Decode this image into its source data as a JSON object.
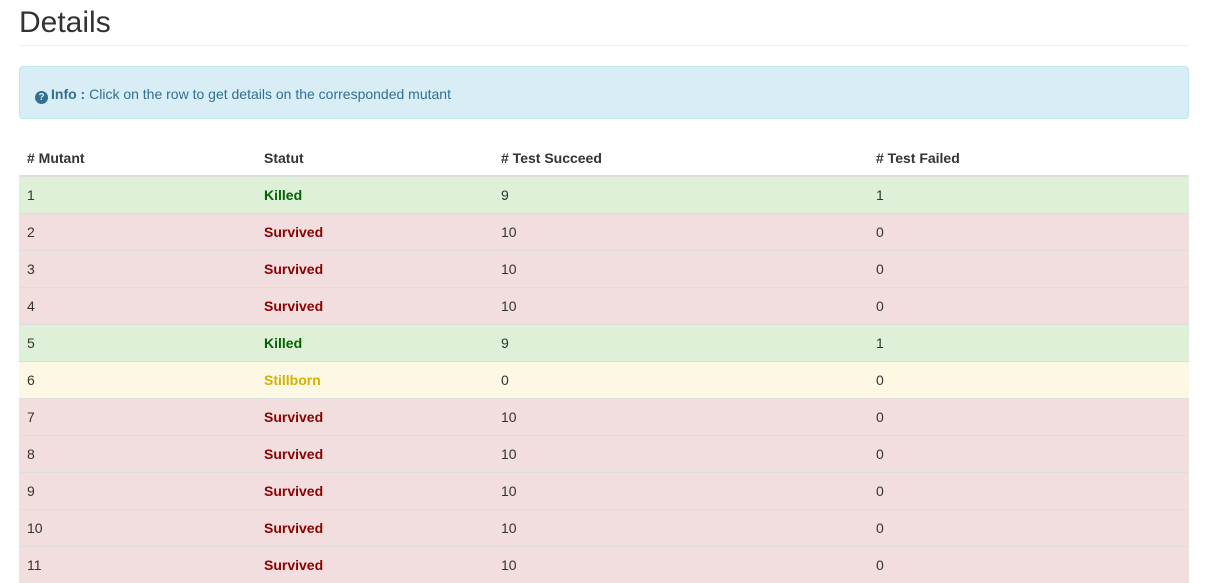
{
  "header": {
    "title": "Details"
  },
  "info": {
    "icon": "question-circle-icon",
    "label": "Info :",
    "text": "Click on the row to get details on the corresponded mutant"
  },
  "table": {
    "columns": [
      "# Mutant",
      "Statut",
      "# Test Succeed",
      "# Test Failed"
    ],
    "rows": [
      {
        "mutant": "1",
        "statut": "Killed",
        "succeed": "9",
        "failed": "1"
      },
      {
        "mutant": "2",
        "statut": "Survived",
        "succeed": "10",
        "failed": "0"
      },
      {
        "mutant": "3",
        "statut": "Survived",
        "succeed": "10",
        "failed": "0"
      },
      {
        "mutant": "4",
        "statut": "Survived",
        "succeed": "10",
        "failed": "0"
      },
      {
        "mutant": "5",
        "statut": "Killed",
        "succeed": "9",
        "failed": "1"
      },
      {
        "mutant": "6",
        "statut": "Stillborn",
        "succeed": "0",
        "failed": "0"
      },
      {
        "mutant": "7",
        "statut": "Survived",
        "succeed": "10",
        "failed": "0"
      },
      {
        "mutant": "8",
        "statut": "Survived",
        "succeed": "10",
        "failed": "0"
      },
      {
        "mutant": "9",
        "statut": "Survived",
        "succeed": "10",
        "failed": "0"
      },
      {
        "mutant": "10",
        "statut": "Survived",
        "succeed": "10",
        "failed": "0"
      },
      {
        "mutant": "11",
        "statut": "Survived",
        "succeed": "10",
        "failed": "0"
      }
    ]
  },
  "colors": {
    "killed_row": "#dff0d8",
    "survived_row": "#f2dede",
    "stillborn_row": "#fcf8e3",
    "killed_text": "#006400",
    "survived_text": "#8b0000",
    "stillborn_text": "#d4b106",
    "info_bg": "#d9edf7",
    "info_text": "#31708f"
  }
}
